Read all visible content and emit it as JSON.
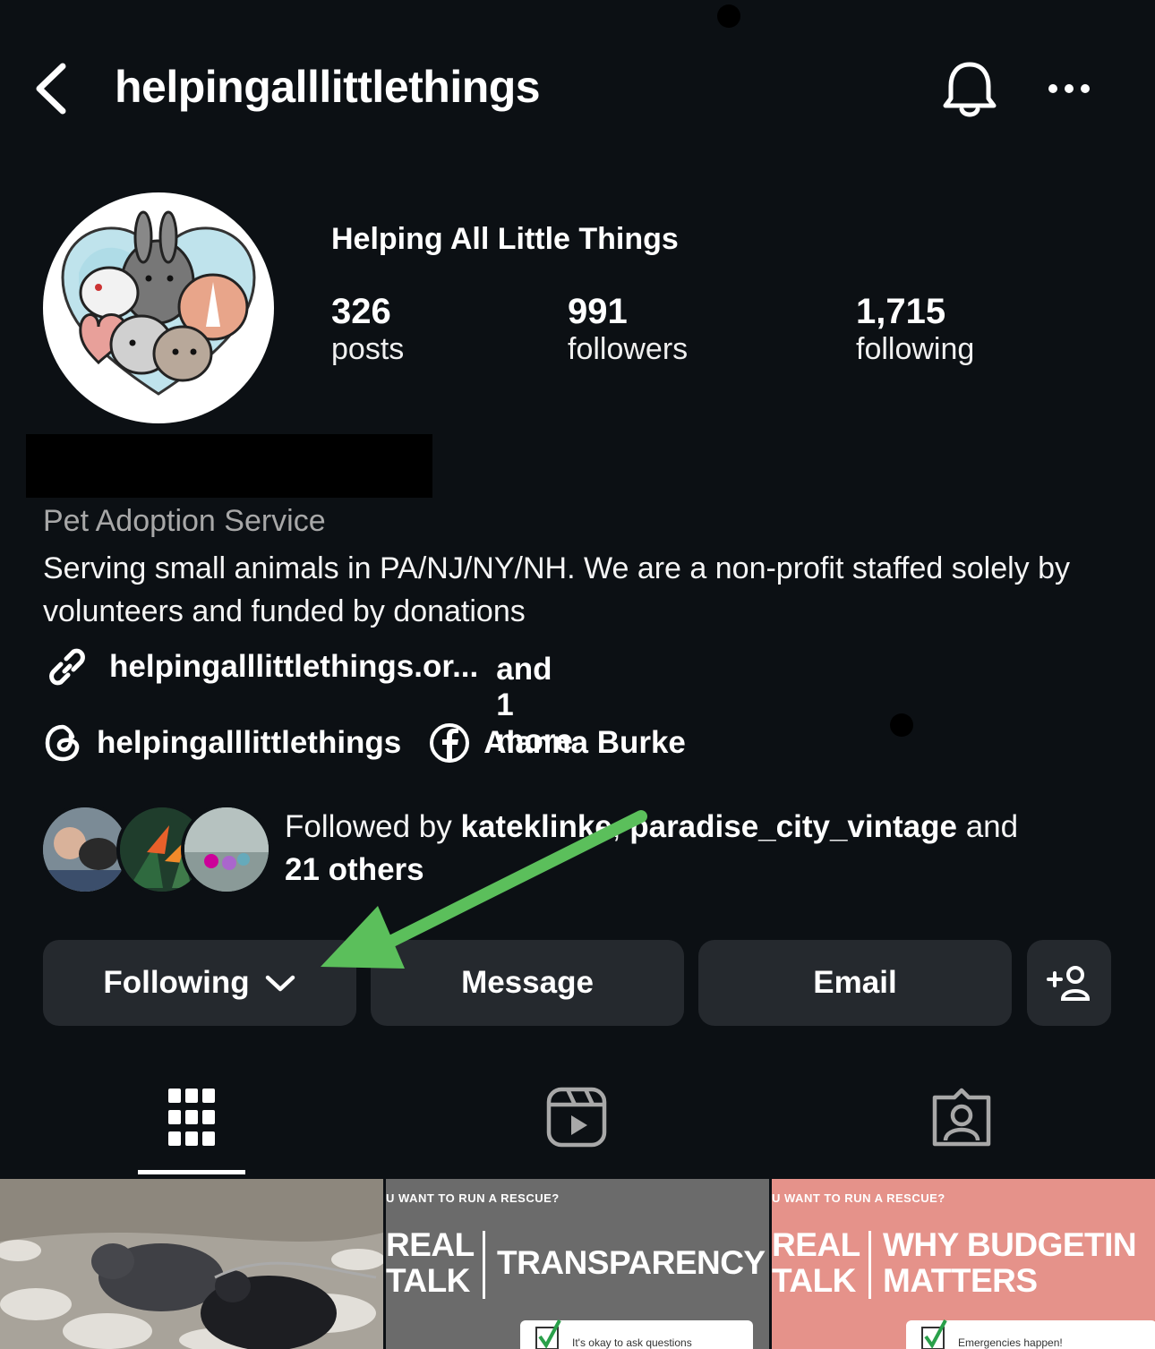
{
  "header": {
    "username": "helpingalllittlethings"
  },
  "profile": {
    "display_name": "Helping All Little Things",
    "stats": [
      {
        "value": "326",
        "label": "posts"
      },
      {
        "value": "991",
        "label": "followers"
      },
      {
        "value": "1,715",
        "label": "following"
      }
    ],
    "category": "Pet Adoption Service",
    "bio": "Serving small animals in PA/NJ/NY/NH. We are a non-profit staffed solely by volunteers and funded by donations",
    "link_text": "helpingalllittlethings.or...",
    "link_more": "and 1 more",
    "threads_handle": "helpingalllittlethings",
    "facebook_name": "Alanna Burke"
  },
  "followed_by": {
    "prefix": "Followed by ",
    "user1": "kateklinke",
    "sep": ", ",
    "user2": "paradise_city_vintage",
    "and": " and",
    "others": "21 others"
  },
  "actions": {
    "following": "Following",
    "message": "Message",
    "email": "Email"
  },
  "tabs": [
    "posts-grid",
    "reels",
    "tagged"
  ],
  "grid": [
    {
      "kind": "photo"
    },
    {
      "kicker": "U WANT TO RUN A RESCUE?",
      "left": "REAL TALK",
      "right": "TRANSPARENCY",
      "note": "It's okay to ask questions"
    },
    {
      "kicker": "U WANT TO RUN A RESCUE?",
      "left": "REAL TALK",
      "right": "WHY BUDGETIN MATTERS",
      "note": "Emergencies happen!"
    }
  ],
  "colors": {
    "background": "#0c1014",
    "button": "#25292e",
    "arrow": "#5bbf5b",
    "tile2": "#6b6b6b",
    "tile3": "#e5928a"
  }
}
